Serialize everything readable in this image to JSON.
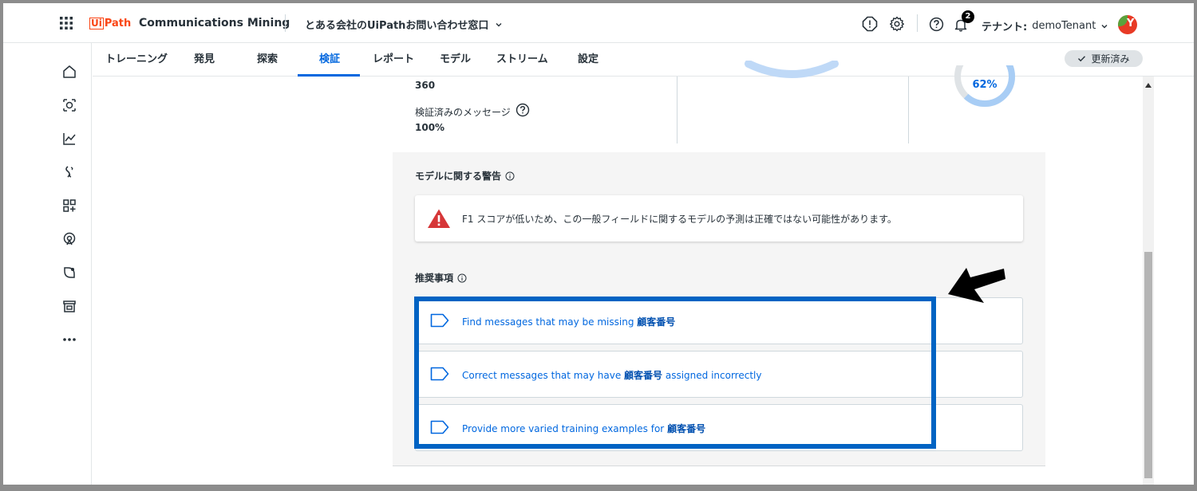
{
  "header": {
    "logo_ui": "Ui",
    "logo_path": "Path",
    "product": "Communications Mining",
    "dataset": "とある会社のUiPathお問い合わせ窓口",
    "notification_count": "2",
    "tenant_label": "テナント:",
    "tenant_name": "demoTenant",
    "avatar_letter": "Y"
  },
  "tabs": [
    {
      "label": "トレーニング"
    },
    {
      "label": "発見"
    },
    {
      "label": "探索"
    },
    {
      "label": "検証"
    },
    {
      "label": "レポート"
    },
    {
      "label": "モデル"
    },
    {
      "label": "ストリーム"
    },
    {
      "label": "設定"
    }
  ],
  "active_tab": "検証",
  "status_pill": "更新済み",
  "metrics": {
    "count_value": "360",
    "verified_label": "検証済みのメッセージ",
    "verified_value": "100%",
    "ring_value": "62%",
    "ring_fraction": 0.62
  },
  "warnings": {
    "title": "モデルに関する警告",
    "message": "F1 スコアが低いため、この一般フィールドに関するモデルの予測は正確ではない可能性があります。"
  },
  "recommendations": {
    "title": "推奨事項",
    "items": [
      {
        "prefix": "Find messages that may be missing ",
        "field": "顧客番号",
        "suffix": ""
      },
      {
        "prefix": "Correct messages that may have ",
        "field": "顧客番号",
        "suffix": " assigned incorrectly"
      },
      {
        "prefix": "Provide more varied training examples for ",
        "field": "顧客番号",
        "suffix": ""
      }
    ]
  },
  "colors": {
    "accent": "#0067df",
    "brand": "#fa4616",
    "warning": "#d63638",
    "highlight": "#0063c3"
  }
}
